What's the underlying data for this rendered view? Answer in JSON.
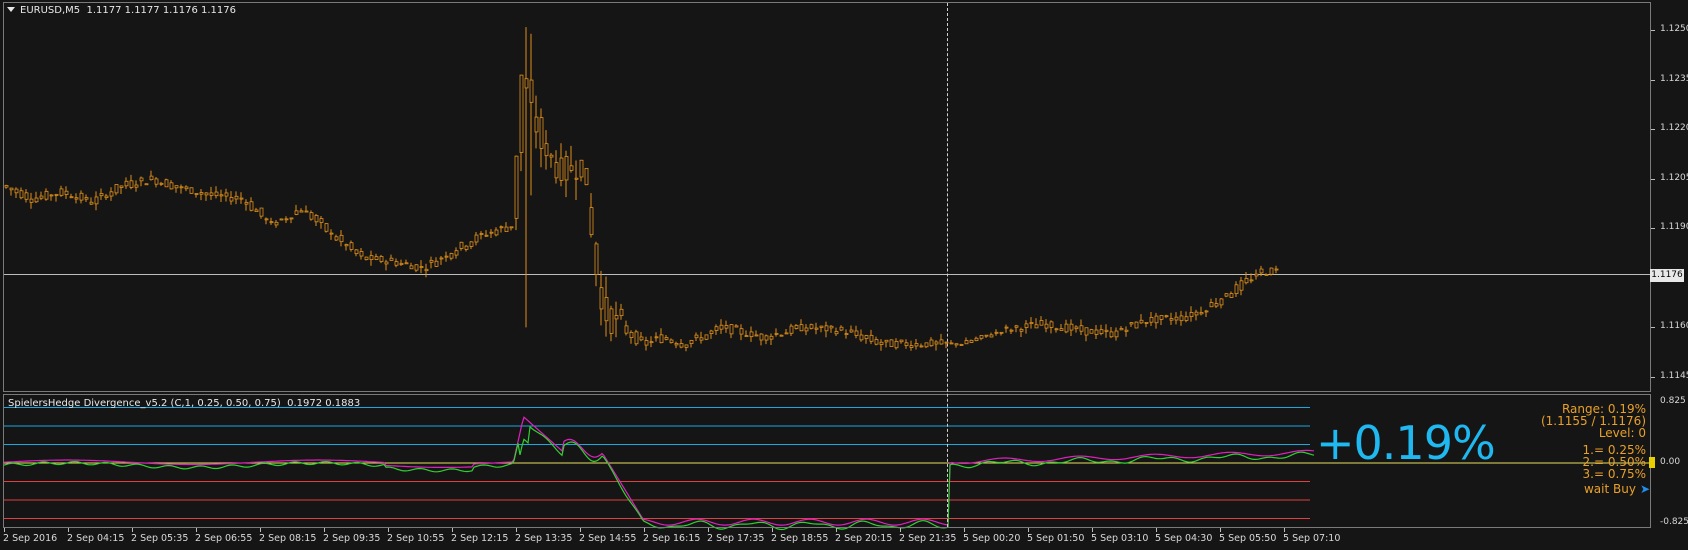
{
  "symbol_header": "EURUSD,M5  1.1177 1.1177 1.1176 1.1176",
  "indicator_header": "SpielersHedge Divergence_v5.2 (C,1, 0.25, 0.50, 0.75)  0.1972 0.1883",
  "price_axis": [
    "1.1250",
    "1.1235",
    "1.1220",
    "1.1205",
    "1.1190",
    "1.1160",
    "1.1145"
  ],
  "current_price": "1.1176",
  "indicator_axis": [
    "0.825",
    "0.00",
    "-0.825"
  ],
  "time_axis": [
    "2 Sep 2016",
    "2 Sep 04:15",
    "2 Sep 05:35",
    "2 Sep 06:55",
    "2 Sep 08:15",
    "2 Sep 09:35",
    "2 Sep 10:55",
    "2 Sep 12:15",
    "2 Sep 13:35",
    "2 Sep 14:55",
    "2 Sep 16:15",
    "2 Sep 17:35",
    "2 Sep 18:55",
    "2 Sep 20:15",
    "2 Sep 21:35",
    "5 Sep 00:20",
    "5 Sep 01:50",
    "5 Sep 03:10",
    "5 Sep 04:30",
    "5 Sep 05:50",
    "5 Sep 07:10"
  ],
  "signal": {
    "big_percent": "+0.19%",
    "range": "Range: 0.19%",
    "range_detail": "(1.1155 / 1.1176)",
    "level": "Level: 0",
    "levels": [
      "1.= 0.25%",
      "2.= 0.50%",
      "3.= 0.75%"
    ],
    "status": "wait Buy",
    "status_arrow": "➤"
  },
  "colors": {
    "background": "#151515",
    "candles": "#e0901a",
    "upper_levels": "#1aa8e0",
    "lower_levels": "#e04040",
    "zero_line": "#e8e060",
    "line_magenta": "#e020c0",
    "line_green": "#30d030",
    "accent_text": "#e8a02a",
    "big_text": "#1fb8f0"
  },
  "chart_data": {
    "type": "candlestick",
    "title": "EURUSD,M5",
    "ylim": [
      1.1141,
      1.1258
    ],
    "price_path": [
      [
        0,
        1.1203
      ],
      [
        30,
        1.1199
      ],
      [
        60,
        1.1201
      ],
      [
        90,
        1.1198
      ],
      [
        120,
        1.1203
      ],
      [
        150,
        1.1205
      ],
      [
        180,
        1.1202
      ],
      [
        210,
        1.12
      ],
      [
        240,
        1.1199
      ],
      [
        270,
        1.1191
      ],
      [
        300,
        1.1196
      ],
      [
        330,
        1.1188
      ],
      [
        360,
        1.1181
      ],
      [
        390,
        1.118
      ],
      [
        420,
        1.1178
      ],
      [
        450,
        1.1183
      ],
      [
        480,
        1.1188
      ],
      [
        500,
        1.119
      ],
      [
        510,
        1.1191
      ],
      [
        520,
        1.1236
      ],
      [
        540,
        1.1215
      ],
      [
        560,
        1.1207
      ],
      [
        580,
        1.121
      ],
      [
        600,
        1.1165
      ],
      [
        620,
        1.116
      ],
      [
        640,
        1.1155
      ],
      [
        660,
        1.1157
      ],
      [
        680,
        1.1155
      ],
      [
        700,
        1.1157
      ],
      [
        720,
        1.116
      ],
      [
        760,
        1.1157
      ],
      [
        800,
        1.116
      ],
      [
        840,
        1.1159
      ],
      [
        880,
        1.1155
      ],
      [
        920,
        1.1155
      ],
      [
        960,
        1.1155
      ],
      [
        1000,
        1.1159
      ],
      [
        1040,
        1.1161
      ],
      [
        1080,
        1.1159
      ],
      [
        1110,
        1.1158
      ],
      [
        1140,
        1.1162
      ],
      [
        1180,
        1.1163
      ],
      [
        1200,
        1.1165
      ],
      [
        1230,
        1.1171
      ],
      [
        1260,
        1.1177
      ],
      [
        1270,
        1.1177
      ]
    ],
    "indicator_levels": [
      0.75,
      0.5,
      0.25,
      0.0,
      -0.25,
      -0.5,
      -0.75
    ]
  }
}
